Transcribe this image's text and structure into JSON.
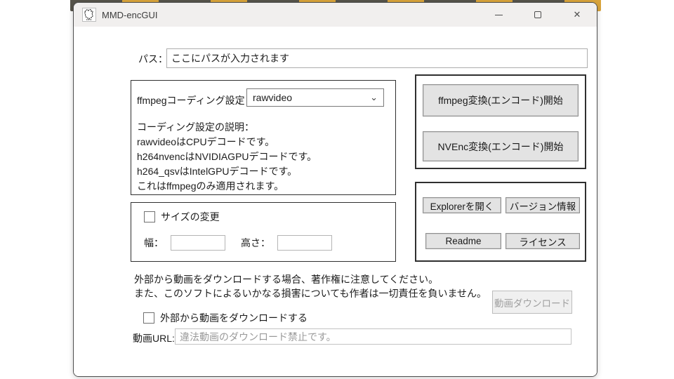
{
  "window": {
    "title": "MMD-encGUI",
    "icons": {
      "close": "✕",
      "chevron_down": "⌄"
    }
  },
  "path": {
    "label": "パス：",
    "value": "ここにパスが入力されます"
  },
  "coding": {
    "group_label": "ffmpegコーディング設定：",
    "selected_option": "rawvideo",
    "description": [
      "コーディング設定の説明：",
      "rawvideoはCPUデコードです。",
      "h264nvencはNVIDIAGPUデコードです。",
      "h264_qsvはIntelGPUデコードです。",
      "これはffmpegのみ適用されます。"
    ]
  },
  "size": {
    "checkbox_label": "サイズの変更",
    "checkbox_checked": false,
    "width_label": "幅：",
    "height_label": "高さ：",
    "width_value": "",
    "height_value": ""
  },
  "encode": {
    "ffmpeg_button": "ffmpeg変換(エンコード)開始",
    "nvenc_button": "NVEnc変換(エンコード)開始"
  },
  "tools": {
    "explorer_button": "Explorerを開く",
    "version_button": "バージョン情報",
    "readme_button": "Readme",
    "license_button": "ライセンス"
  },
  "download": {
    "warning_line1": "外部から動画をダウンロードする場合、著作権に注意してください。",
    "warning_line2": "また、このソフトによるいかなる損害についても作者は一切責任を負いません。",
    "checkbox_label": "外部から動画をダウンロードする",
    "checkbox_checked": false,
    "url_label": "動画URL:",
    "url_placeholder": "違法動画のダウンロード禁止です。",
    "download_button": "動画ダウンロード",
    "download_button_enabled": false
  },
  "colors": {
    "titlebar_bg": "#f1efee",
    "window_bg": "#ffffff",
    "groupbox_border": "#2f2f2f",
    "button_bg": "#e3e3e3",
    "wallpaper_gold": "#d9a43b",
    "wallpaper_dark": "#57544b",
    "disabled_text": "#a0a0a0"
  }
}
